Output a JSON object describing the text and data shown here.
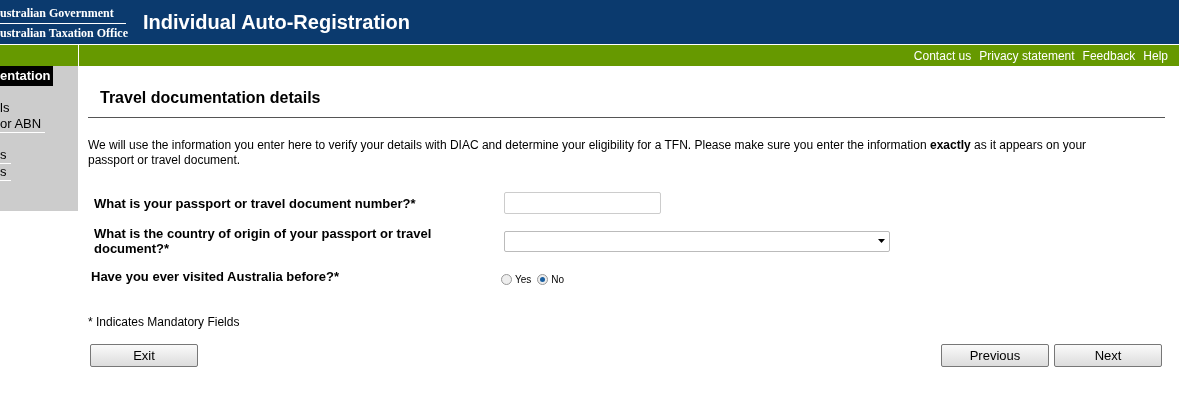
{
  "header": {
    "agency_line_1": "ustralian Government",
    "agency_line_2": "ustralian Taxation Office",
    "title": "Individual Auto-Registration"
  },
  "top_links": [
    "Contact us",
    "Privacy statement",
    "Feedback",
    "Help"
  ],
  "sidebar": {
    "items": [
      {
        "label": "entation",
        "selected": true,
        "underlined": false
      },
      {
        "label": "ls",
        "selected": false,
        "underlined": false
      },
      {
        "label": "or ABN",
        "selected": false,
        "underlined": true
      },
      {
        "label": "s",
        "selected": false,
        "underlined": true
      },
      {
        "label": "s",
        "selected": false,
        "underlined": true
      }
    ]
  },
  "page_title": "Travel documentation details",
  "intro": "We will use the information you enter here to verify your details with DIAC and determine your eligibility for a TFN. Please make sure you enter the information **exactly** as it appears on your passport or travel document.",
  "questions": [
    {
      "kind": "text",
      "label": "What is your passport or travel document number?*"
    },
    {
      "kind": "select",
      "label": "What is the country of origin of your passport or travel document?*"
    },
    {
      "kind": "radio",
      "label": "Have you ever visited Australia before?*",
      "options": [
        {
          "label": "Yes",
          "selected": false
        },
        {
          "label": "No",
          "selected": true
        }
      ]
    }
  ],
  "mandatory_note": "* Indicates Mandatory Fields",
  "buttons": {
    "left": [
      "Exit"
    ],
    "right": [
      "Previous",
      "Next"
    ]
  }
}
